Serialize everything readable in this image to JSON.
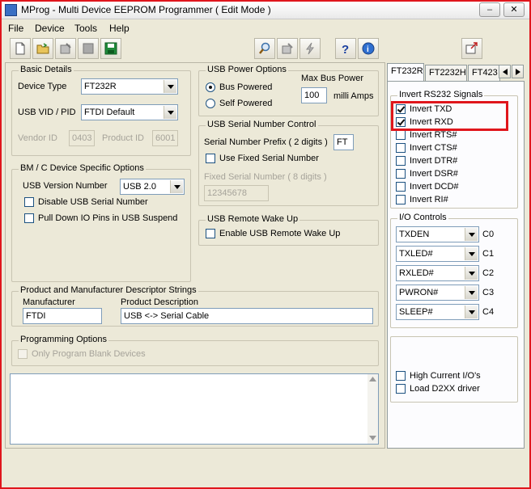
{
  "window": {
    "title": "MProg - Multi Device EEPROM Programmer ( Edit Mode )",
    "minimize_label": "–",
    "close_label": "✕",
    "accent_color": "#e0161c"
  },
  "menu": {
    "items": [
      "File",
      "Device",
      "Tools",
      "Help"
    ]
  },
  "toolbar": {
    "icons": [
      "new-file-icon",
      "open-folder-icon",
      "edit-icon",
      "stop-icon",
      "save-icon",
      "search-icon",
      "erase-icon",
      "program-icon",
      "help-icon",
      "info-icon",
      "exit-icon"
    ],
    "help_glyph": "?",
    "info_glyph": "i"
  },
  "basic_details": {
    "title": "Basic Details",
    "device_type_label": "Device Type",
    "device_type_value": "FT232R",
    "vid_pid_label": "USB VID / PID",
    "vid_pid_value": "FTDI Default",
    "vendor_id_label": "Vendor ID",
    "vendor_id_value": "0403",
    "product_id_label": "Product ID",
    "product_id_value": "6001"
  },
  "bm_options": {
    "title": "BM / C Device Specific Options",
    "usb_version_label": "USB Version Number",
    "usb_version_value": "USB 2.0",
    "disable_serial_label": "Disable USB Serial Number",
    "pull_down_label": "Pull Down IO Pins in USB Suspend"
  },
  "power": {
    "title": "USB Power Options",
    "bus_powered_label": "Bus Powered",
    "self_powered_label": "Self Powered",
    "max_bus_power_label": "Max Bus Power",
    "max_bus_power_value": "100",
    "unit_label": "milli Amps"
  },
  "serial": {
    "title": "USB Serial Number Control",
    "prefix_label": "Serial Number Prefix ( 2 digits )",
    "prefix_value": "FT",
    "use_fixed_label": "Use Fixed Serial Number",
    "fixed_label": "Fixed Serial Number ( 8 digits )",
    "fixed_value": "12345678"
  },
  "wake": {
    "title": "USB Remote Wake Up",
    "enable_label": "Enable USB Remote Wake Up"
  },
  "descriptor": {
    "title": "Product and Manufacturer Descriptor Strings",
    "manufacturer_label": "Manufacturer",
    "manufacturer_value": "FTDI",
    "product_label": "Product Description",
    "product_value": "USB <-> Serial Cable"
  },
  "programming": {
    "title": "Programming Options",
    "blank_only_label": "Only Program Blank Devices"
  },
  "tabs": [
    "FT232R",
    "FT2232H",
    "FT423"
  ],
  "invert": {
    "title": "Invert RS232 Signals",
    "items": [
      {
        "label": "Invert TXD",
        "checked": true
      },
      {
        "label": "Invert RXD",
        "checked": true
      },
      {
        "label": "Invert RTS#",
        "checked": false
      },
      {
        "label": "Invert CTS#",
        "checked": false
      },
      {
        "label": "Invert DTR#",
        "checked": false
      },
      {
        "label": "Invert DSR#",
        "checked": false
      },
      {
        "label": "Invert DCD#",
        "checked": false
      },
      {
        "label": "Invert RI#",
        "checked": false
      }
    ]
  },
  "io": {
    "title": "I/O Controls",
    "rows": [
      {
        "value": "TXDEN",
        "label": "C0"
      },
      {
        "value": "TXLED#",
        "label": "C1"
      },
      {
        "value": "RXLED#",
        "label": "C2"
      },
      {
        "value": "PWRON#",
        "label": "C3"
      },
      {
        "value": "SLEEP#",
        "label": "C4"
      }
    ]
  },
  "extra": {
    "high_current_label": "High Current I/O's",
    "load_d2xx_label": "Load D2XX driver"
  }
}
